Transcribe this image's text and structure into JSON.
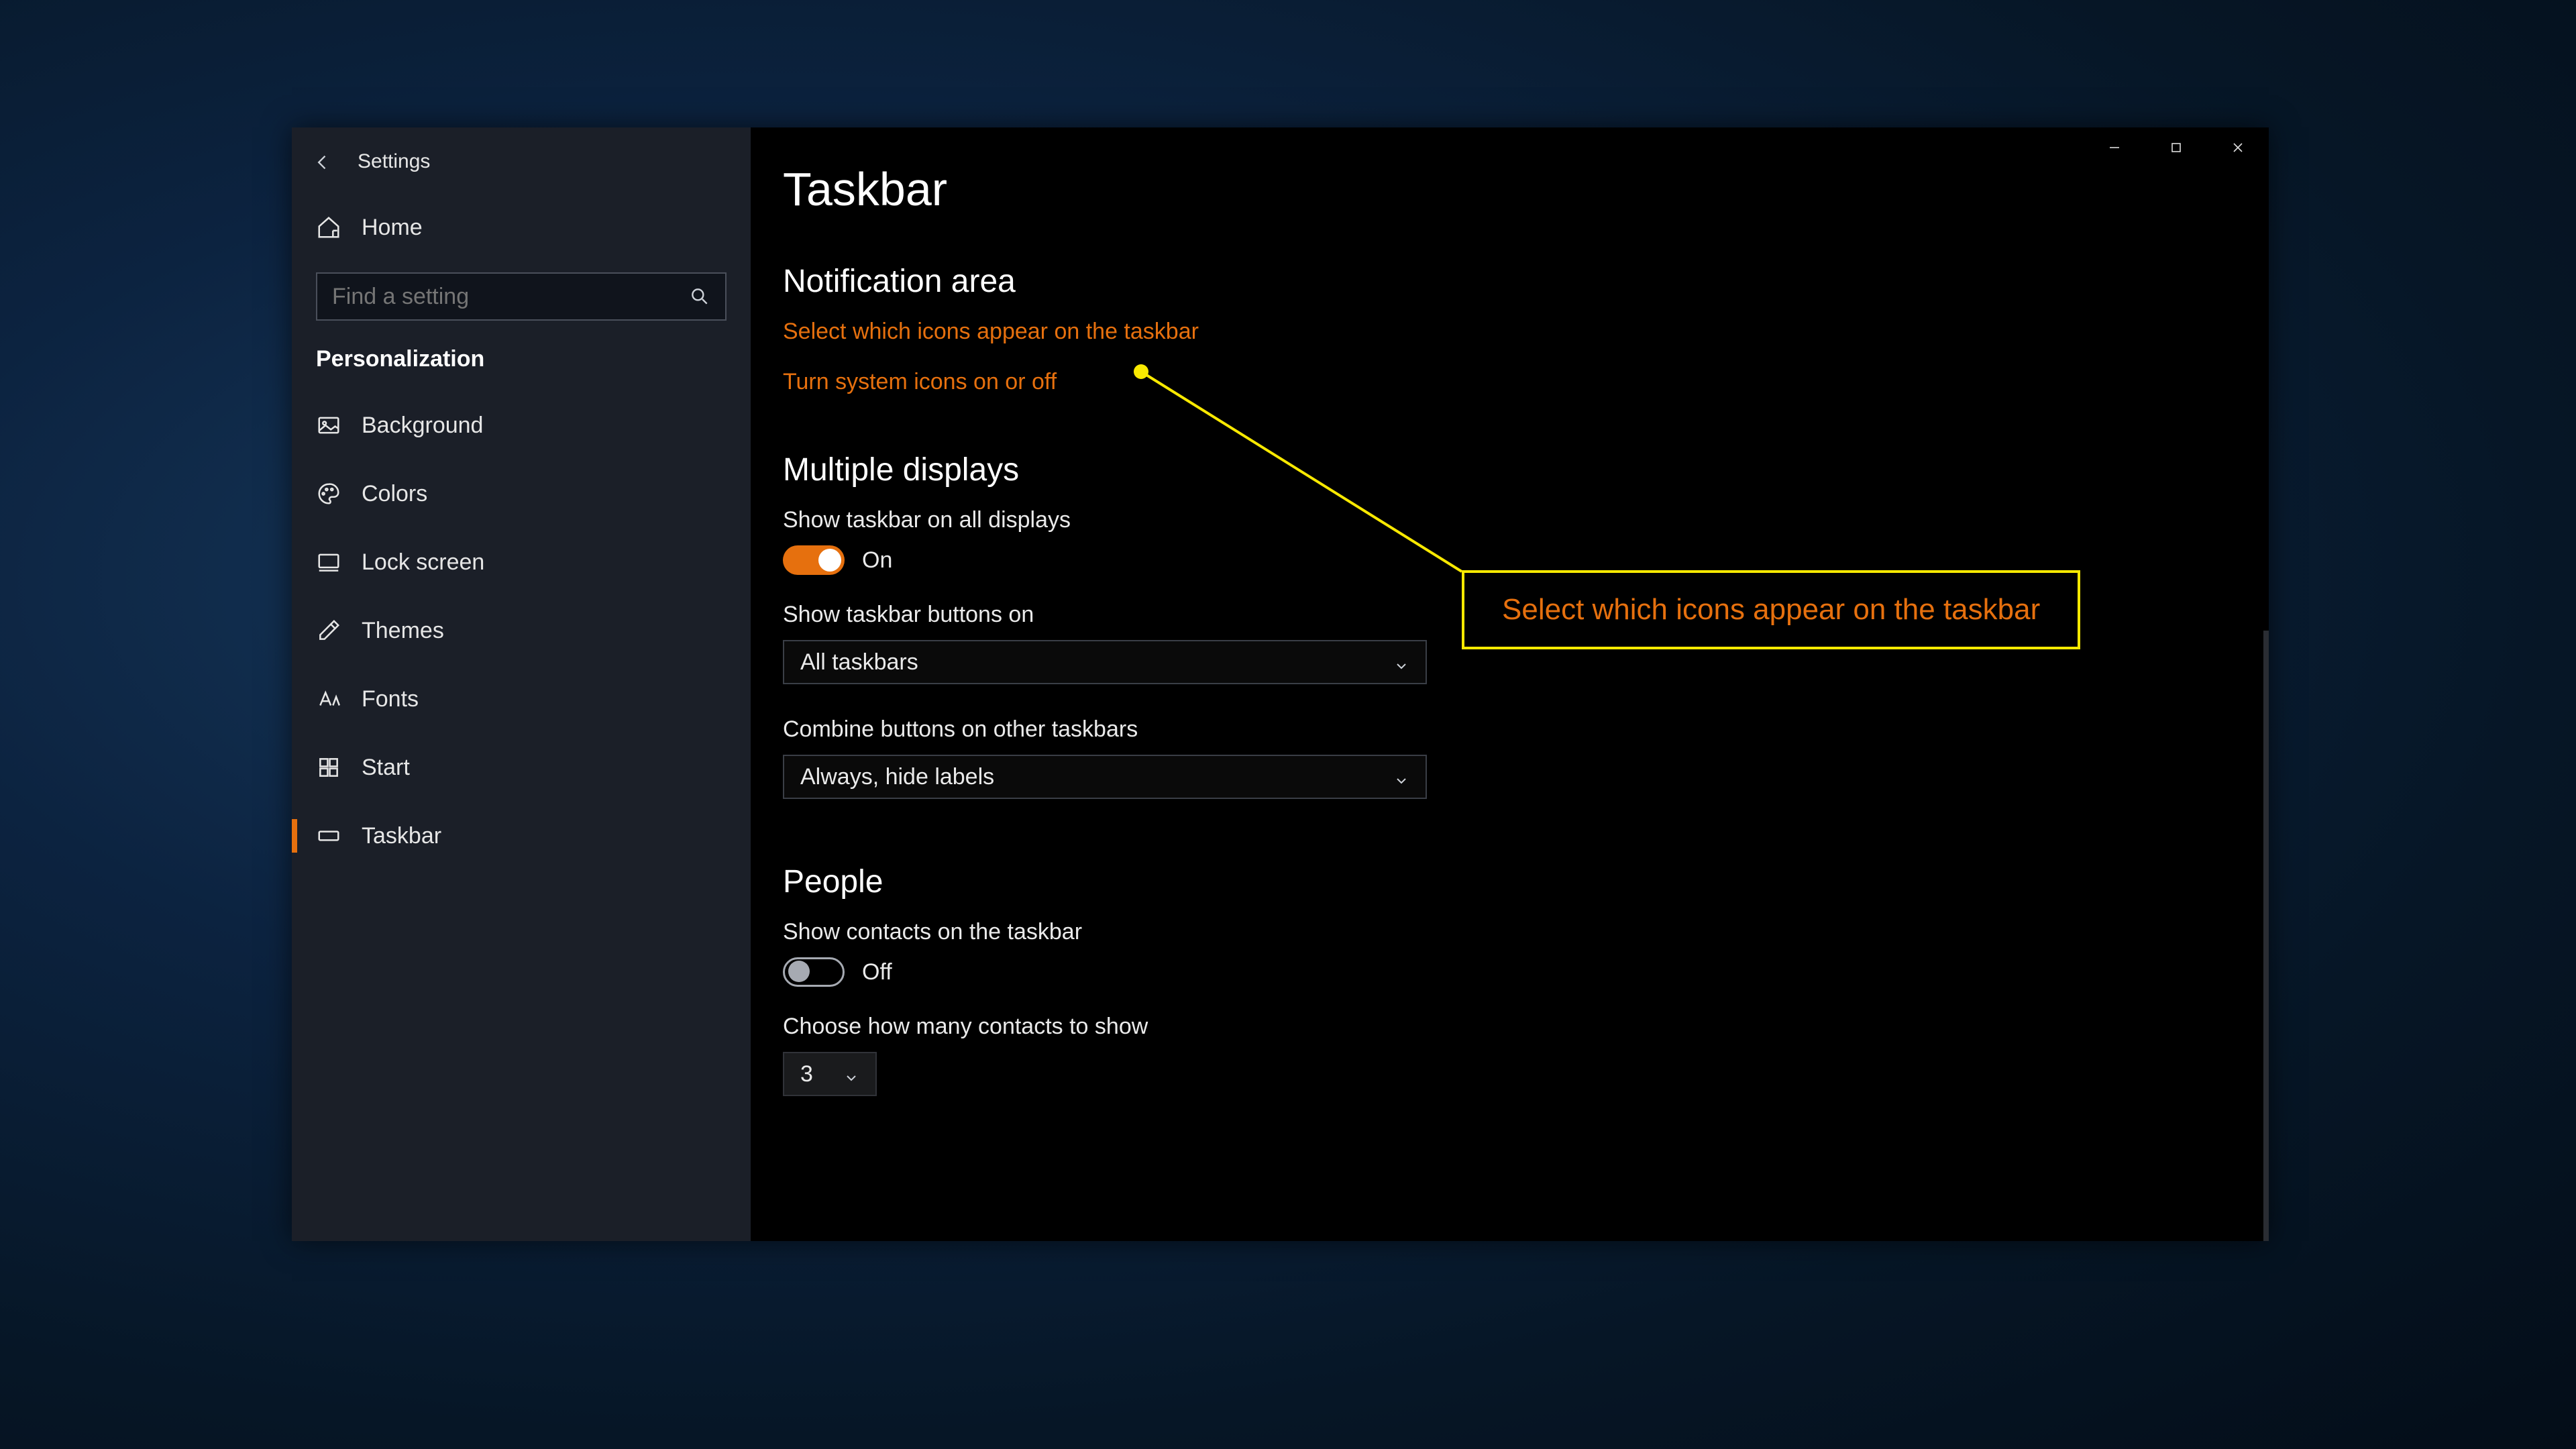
{
  "app": {
    "title": "Settings"
  },
  "sidebar": {
    "home_label": "Home",
    "search_placeholder": "Find a setting",
    "section": "Personalization",
    "items": [
      {
        "label": "Background"
      },
      {
        "label": "Colors"
      },
      {
        "label": "Lock screen"
      },
      {
        "label": "Themes"
      },
      {
        "label": "Fonts"
      },
      {
        "label": "Start"
      },
      {
        "label": "Taskbar"
      }
    ]
  },
  "page": {
    "title": "Taskbar",
    "notification": {
      "title": "Notification area",
      "link_select_icons": "Select which icons appear on the taskbar",
      "link_system_icons": "Turn system icons on or off"
    },
    "multiple_displays": {
      "title": "Multiple displays",
      "show_all_label": "Show taskbar on all displays",
      "show_all_state": "On",
      "show_buttons_label": "Show taskbar buttons on",
      "show_buttons_value": "All taskbars",
      "combine_label": "Combine buttons on other taskbars",
      "combine_value": "Always, hide labels"
    },
    "people": {
      "title": "People",
      "show_contacts_label": "Show contacts on the taskbar",
      "show_contacts_state": "Off",
      "choose_count_label": "Choose how many contacts to show",
      "choose_count_value": "3"
    }
  },
  "callout": {
    "text": "Select which icons appear on the taskbar"
  }
}
